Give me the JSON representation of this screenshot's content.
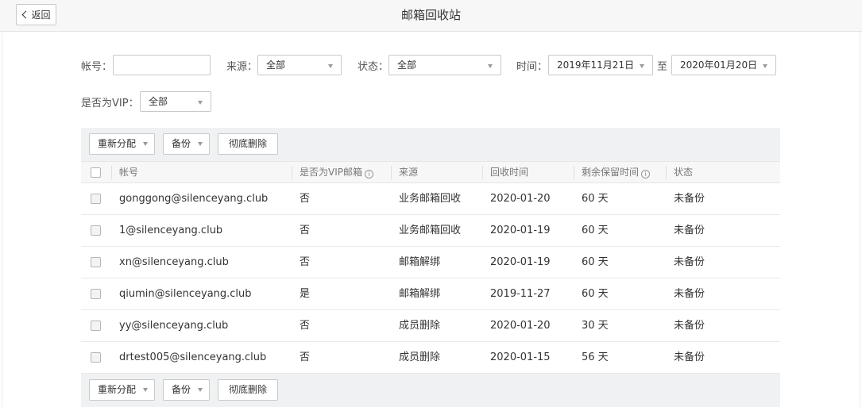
{
  "header": {
    "back_label": "返回",
    "title": "邮箱回收站"
  },
  "filters": {
    "account_label": "帐号：",
    "account_value": "",
    "source_label": "来源：",
    "source_value": "全部",
    "status_label": "状态：",
    "status_value": "全部",
    "time_label": "时间：",
    "time_start": "2019年11月21日",
    "time_sep": "至",
    "time_end": "2020年01月20日",
    "vip_label": "是否为VIP：",
    "vip_value": "全部"
  },
  "toolbar": {
    "reassign_label": "重新分配",
    "backup_label": "备份",
    "delete_label": "彻底删除"
  },
  "table": {
    "columns": [
      "帐号",
      "是否为VIP邮箱",
      "来源",
      "回收时间",
      "剩余保留时间",
      "状态"
    ],
    "rows": [
      {
        "account": "gonggong@silenceyang.club",
        "vip": "否",
        "source": "业务邮箱回收",
        "time": "2020-01-20",
        "remain": "60 天",
        "status": "未备份"
      },
      {
        "account": "1@silenceyang.club",
        "vip": "否",
        "source": "业务邮箱回收",
        "time": "2020-01-19",
        "remain": "60 天",
        "status": "未备份"
      },
      {
        "account": "xn@silenceyang.club",
        "vip": "否",
        "source": "邮箱解绑",
        "time": "2020-01-19",
        "remain": "60 天",
        "status": "未备份"
      },
      {
        "account": "qiumin@silenceyang.club",
        "vip": "是",
        "source": "邮箱解绑",
        "time": "2019-11-27",
        "remain": "60 天",
        "status": "未备份"
      },
      {
        "account": "yy@silenceyang.club",
        "vip": "否",
        "source": "成员删除",
        "time": "2020-01-20",
        "remain": "30 天",
        "status": "未备份"
      },
      {
        "account": "drtest005@silenceyang.club",
        "vip": "否",
        "source": "成员删除",
        "time": "2020-01-15",
        "remain": "56 天",
        "status": "未备份"
      }
    ]
  },
  "icons": {
    "back": "chevron-left-icon",
    "caret": "caret-down-icon",
    "info": "info-icon",
    "info_glyph": "i"
  }
}
